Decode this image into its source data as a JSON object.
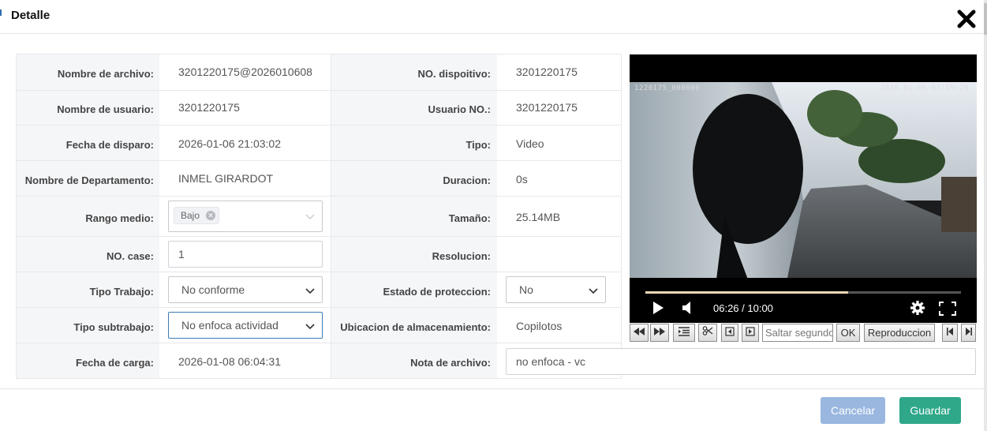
{
  "header": {
    "title": "Detalle"
  },
  "fields": {
    "nombre_archivo": {
      "label": "Nombre de archivo:",
      "value": "3201220175@2026010608"
    },
    "no_dispositivo": {
      "label": "NO. dispoitivo:",
      "value": "3201220175"
    },
    "nombre_usuario": {
      "label": "Nombre de usuario:",
      "value": "3201220175"
    },
    "usuario_no": {
      "label": "Usuario NO.:",
      "value": "3201220175"
    },
    "fecha_disparo": {
      "label": "Fecha de disparo:",
      "value": "2026-01-06 21:03:02"
    },
    "tipo": {
      "label": "Tipo:",
      "value": "Video"
    },
    "departamento": {
      "label": "Nombre de Departamento:",
      "value": "INMEL GIRARDOT"
    },
    "duracion": {
      "label": "Duracion:",
      "value": "0s"
    },
    "rango_medio": {
      "label": "Rango medio:",
      "tag": "Bajo"
    },
    "tamano": {
      "label": "Tamaño:",
      "value": "25.14MB"
    },
    "no_case": {
      "label": "NO. case:",
      "value": "1"
    },
    "resolucion": {
      "label": "Resolucion:",
      "value": ""
    },
    "tipo_trabajo": {
      "label": "Tipo Trabajo:",
      "value": "No conforme"
    },
    "estado_proteccion": {
      "label": "Estado de proteccion:",
      "value": "No"
    },
    "tipo_subtrabajo": {
      "label": "Tipo subtrabajo:",
      "value": "No enfoca actividad"
    },
    "ubicacion": {
      "label": "Ubicacion de almacenamiento:",
      "value": "Copilotos"
    },
    "fecha_carga": {
      "label": "Fecha de carga:",
      "value": "2026-01-08 06:04:31"
    },
    "nota_archivo": {
      "label": "Nota de archivo:",
      "value": "no enfoca - vc"
    }
  },
  "player": {
    "osd_left": "1220175_000000",
    "osd_right": "2026-01-06  07:59:29",
    "time": "06:26 / 10:00",
    "progress": 0.643
  },
  "toolbar": {
    "seek_placeholder": "Saltar segundos",
    "ok_label": "OK",
    "playback_label": "Reproduccion"
  },
  "footer": {
    "cancel_label": "Cancelar",
    "save_label": "Guardar"
  },
  "colors": {
    "save": "#2fa88a",
    "cancel": "#9ab7e0",
    "focus": "#3d7bb3"
  }
}
